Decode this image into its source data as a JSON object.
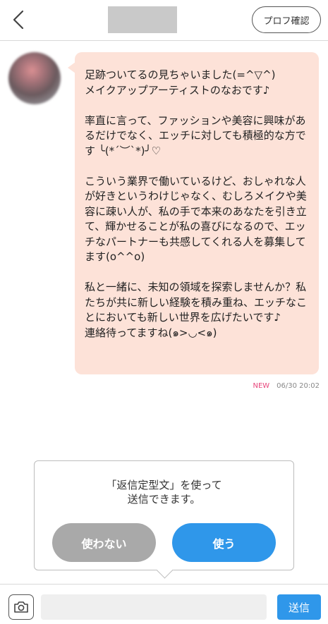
{
  "header": {
    "back_icon": "chevron-left-icon",
    "profile_button_label": "プロフ確認"
  },
  "message": {
    "text": "足跡ついてるの見ちゃいました(=^▽^)\nメイクアップアーティストのなおです♪\n\n率直に言って、ファッションや美容に興味があるだけでなく、エッチに対しても積極的な方です ╰(*´︶`*)╯♡\n\nこういう業界で働いているけど、おしゃれな人が好きというわけじゃなく、むしろメイクや美容に疎い人が、私の手で本来のあなたを引き立て、輝かせることが私の喜びになるので、エッチなパートナーも共感してくれる人を募集してます(o^^o)\n\n私と一緒に、未知の領域を探索しませんか？私たちが共に新しい経験を積み重ね、エッチなことにおいても新しい世界を広げたいです♪\n連絡待ってますね(๑>◡<๑)",
    "new_badge": "NEW",
    "timestamp": "06/30 20:02"
  },
  "popup": {
    "message_line1": "「返信定型文」を使って",
    "message_line2": "送信できます。",
    "decline_label": "使わない",
    "accept_label": "使う"
  },
  "input_bar": {
    "camera_icon": "camera-icon",
    "placeholder": "",
    "send_label": "送信"
  },
  "colors": {
    "bubble": "#fde2d8",
    "accent": "#2f97ea",
    "new_badge": "#e8467c",
    "decline_button": "#a9a9a9"
  }
}
